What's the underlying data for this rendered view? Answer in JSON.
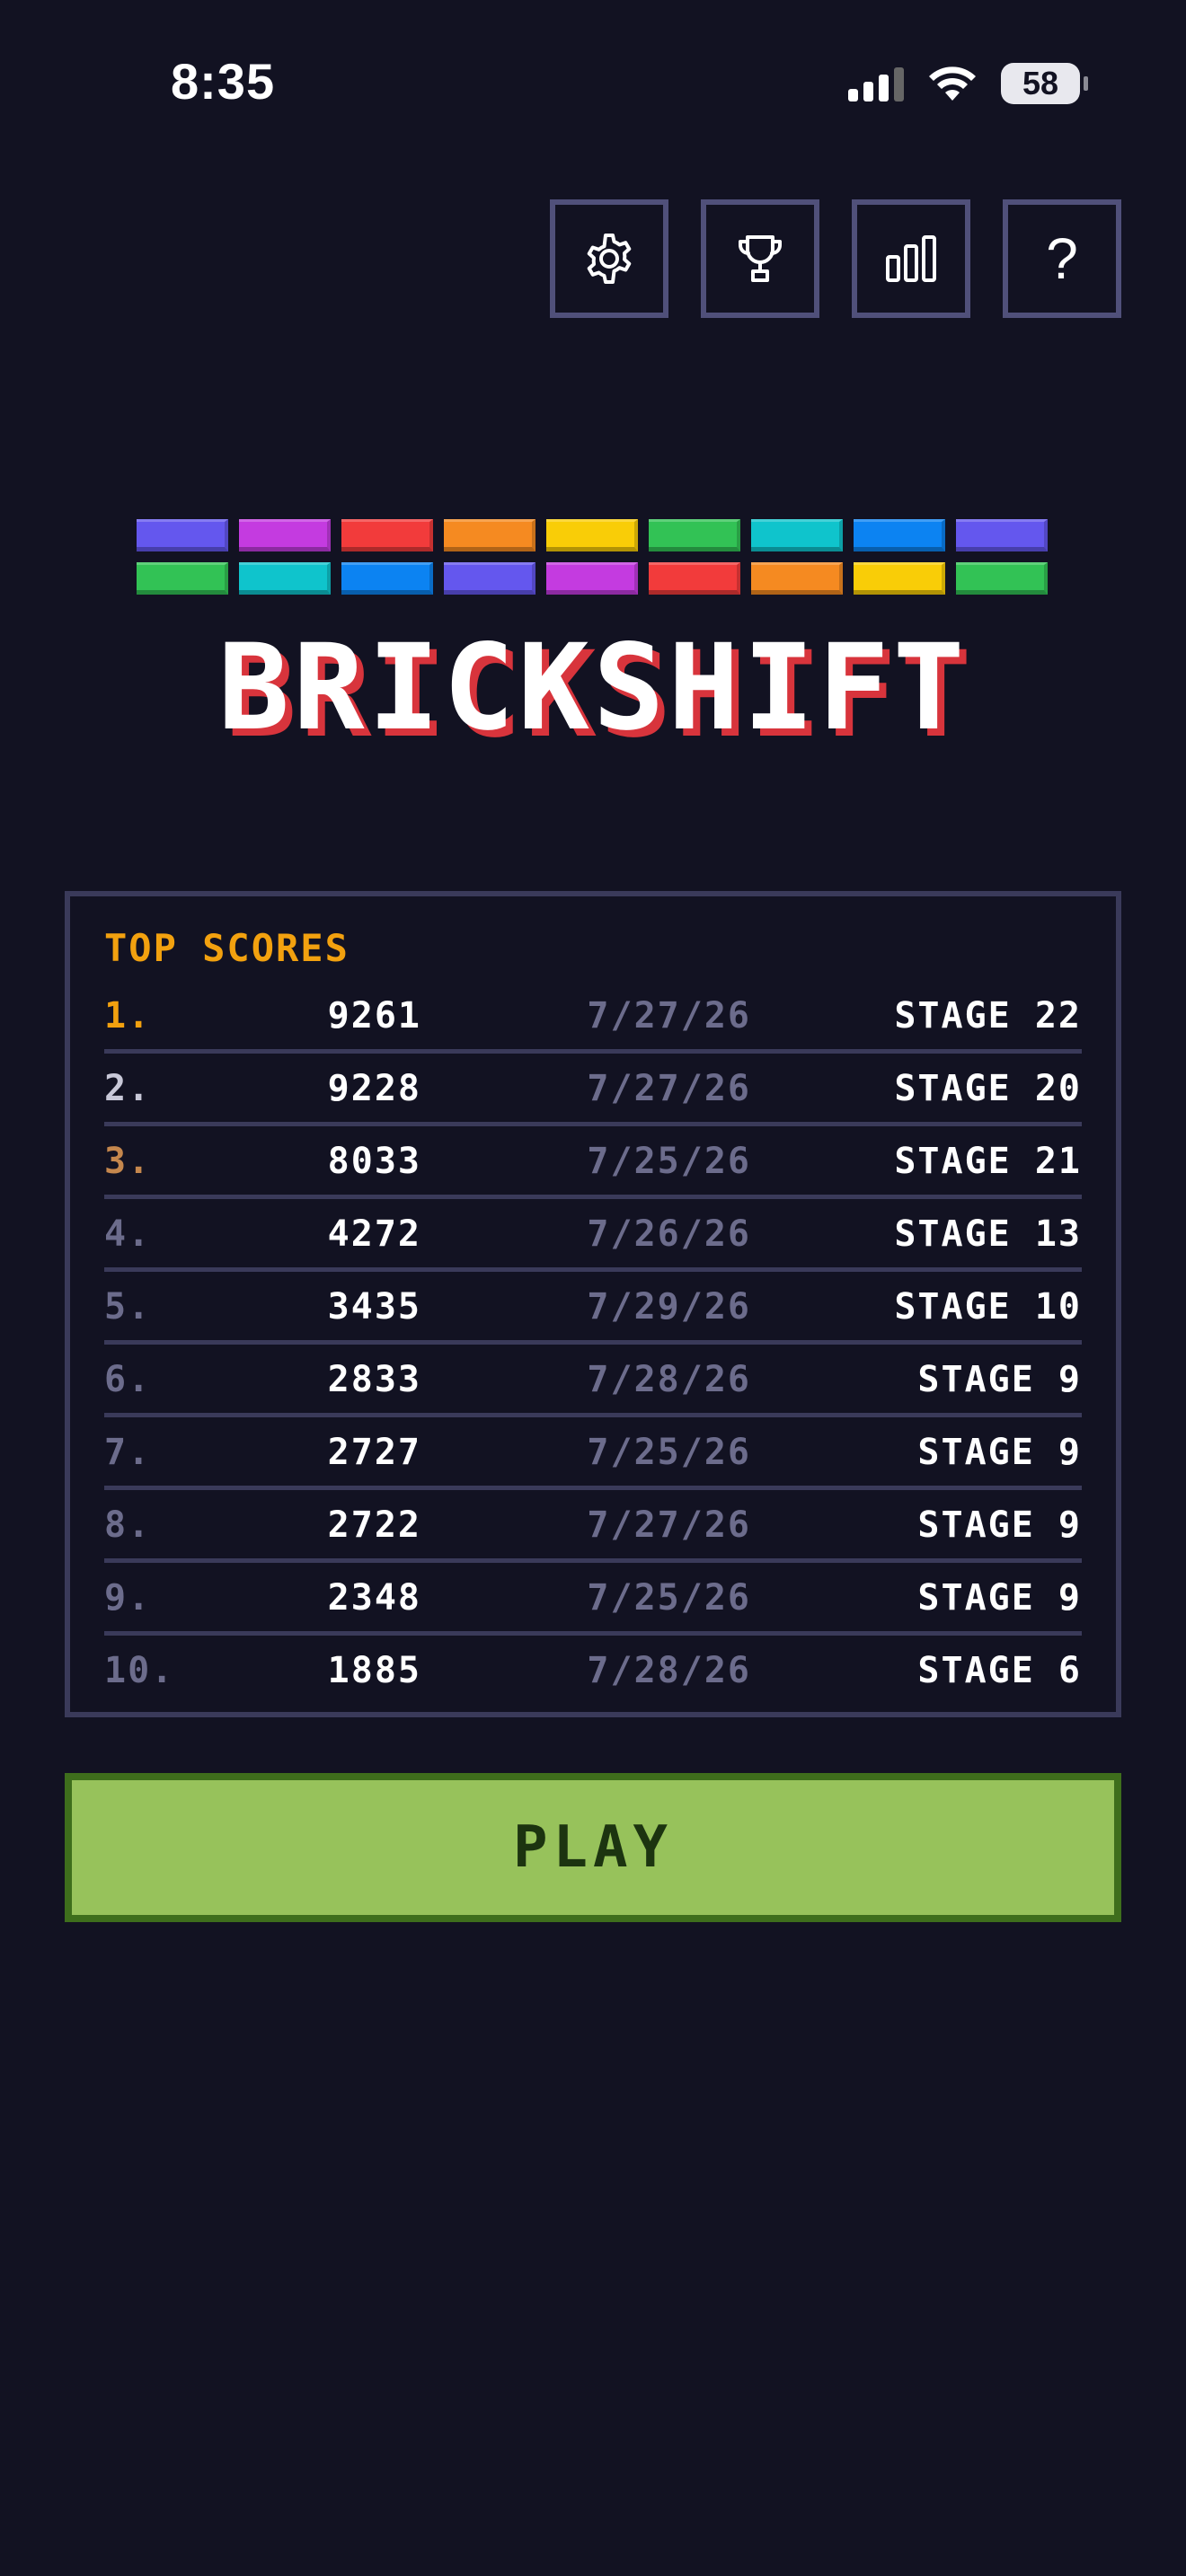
{
  "status_bar": {
    "time": "8:35",
    "battery": "58"
  },
  "toolbar": {
    "buttons": [
      {
        "name": "settings",
        "icon": "gear-icon"
      },
      {
        "name": "achievements",
        "icon": "trophy-icon"
      },
      {
        "name": "stats",
        "icon": "bar-chart-icon"
      },
      {
        "name": "help",
        "icon": "question-mark-icon",
        "glyph": "?"
      }
    ]
  },
  "logo": {
    "title": "BRICKSHIFT",
    "title_shadow_color": "#d8343c",
    "brick_rows": [
      [
        "#6457ee",
        "#c43be0",
        "#f23b3b",
        "#f58a21",
        "#f9cd07",
        "#32c255",
        "#0fc4cc",
        "#0c83f2",
        "#6457ee"
      ],
      [
        "#32c255",
        "#0fc4cc",
        "#0c83f2",
        "#6457ee",
        "#c43be0",
        "#f23b3b",
        "#f58a21",
        "#f9cd07",
        "#32c255"
      ]
    ]
  },
  "scores": {
    "heading": "TOP SCORES",
    "rows": [
      {
        "rank": "1.",
        "score": "9261",
        "date": "7/27/26",
        "stage": "STAGE 22",
        "rank_color": "#f2a10f"
      },
      {
        "rank": "2.",
        "score": "9228",
        "date": "7/27/26",
        "stage": "STAGE 20",
        "rank_color": "#c8c8d8"
      },
      {
        "rank": "3.",
        "score": "8033",
        "date": "7/25/26",
        "stage": "STAGE 21",
        "rank_color": "#c5874d"
      },
      {
        "rank": "4.",
        "score": "4272",
        "date": "7/26/26",
        "stage": "STAGE 13",
        "rank_color": "#6c6c8c"
      },
      {
        "rank": "5.",
        "score": "3435",
        "date": "7/29/26",
        "stage": "STAGE 10",
        "rank_color": "#6c6c8c"
      },
      {
        "rank": "6.",
        "score": "2833",
        "date": "7/28/26",
        "stage": "STAGE 9",
        "rank_color": "#6c6c8c"
      },
      {
        "rank": "7.",
        "score": "2727",
        "date": "7/25/26",
        "stage": "STAGE 9",
        "rank_color": "#6c6c8c"
      },
      {
        "rank": "8.",
        "score": "2722",
        "date": "7/27/26",
        "stage": "STAGE 9",
        "rank_color": "#6c6c8c"
      },
      {
        "rank": "9.",
        "score": "2348",
        "date": "7/25/26",
        "stage": "STAGE 9",
        "rank_color": "#6c6c8c"
      },
      {
        "rank": "10.",
        "score": "1885",
        "date": "7/28/26",
        "stage": "STAGE 6",
        "rank_color": "#6c6c8c"
      }
    ]
  },
  "play": {
    "label": "PLAY"
  },
  "colors": {
    "background": "#121222",
    "panel_border": "#3a3a5a",
    "accent_orange": "#f2a10f",
    "play_green": "#97c25b",
    "play_border": "#3e6e1c"
  }
}
